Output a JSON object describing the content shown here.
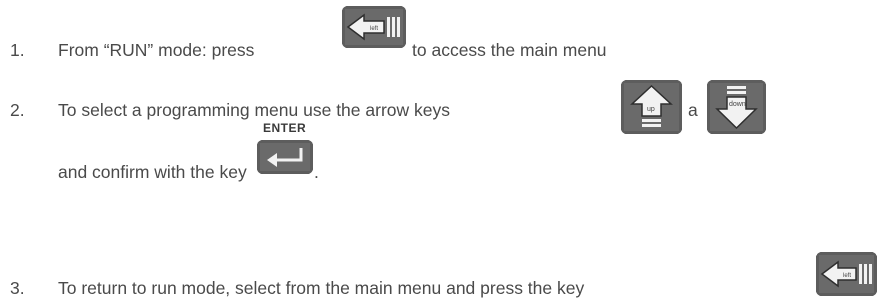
{
  "steps": [
    {
      "number": "1.",
      "text_before": "From “RUN” mode: press",
      "key": "left-key",
      "text_after": "to access the main menu"
    },
    {
      "number": "2.",
      "text_before": "To select a programming menu use the arrow keys",
      "keys": [
        "up-key",
        "down-key"
      ],
      "connector": "a",
      "line2_text": "and confirm with the key",
      "line2_key": "enter-key",
      "line2_end": "."
    },
    {
      "number": "3.",
      "text_before": "To return to run mode, select from the main menu and press the key",
      "key": "left-key"
    }
  ],
  "key_labels": {
    "left": "left",
    "up": "up",
    "down": "down",
    "enter": "ENTER"
  }
}
